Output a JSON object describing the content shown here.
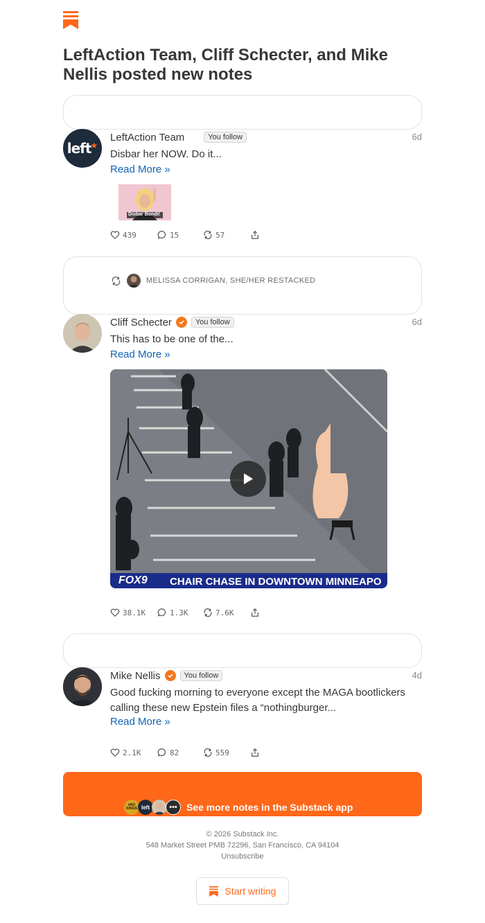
{
  "headline": "LeftAction Team, Cliff Schecter, and Mike Nellis posted new notes",
  "colors": {
    "brand": "#ff6719",
    "link": "#0f65b3",
    "verified": "#f4781f",
    "text": "#363737"
  },
  "notes": [
    {
      "author": "LeftAction Team",
      "verified": false,
      "follow_label": "You follow",
      "age": "6d",
      "text": "Disbar her NOW. Do it...",
      "read_more": "Read More",
      "avatar_text": "left",
      "image_caption": "Disbar Bondi!",
      "likes": "439",
      "comments": "15",
      "restacks": "57"
    },
    {
      "restacked_by": "MELISSA CORRIGAN, SHE/HER RESTACKED",
      "author": "Cliff Schecter",
      "verified": true,
      "follow_label": "You follow",
      "age": "6d",
      "text": "This has to be one of the...",
      "read_more": "Read More",
      "video_channel": "FOX9",
      "video_caption": "CHAIR CHASE IN DOWNTOWN MINNEAPO",
      "likes": "38.1K",
      "comments": "1.3K",
      "restacks": "7.6K"
    },
    {
      "author": "Mike Nellis",
      "verified": true,
      "follow_label": "You follow",
      "age": "4d",
      "text": "Good fucking morning to everyone except the MAGA bootlickers calling these new Epstein files a “nothingburger...",
      "read_more": "Read More",
      "likes": "2.1K",
      "comments": "82",
      "restacks": "559"
    }
  ],
  "cta": {
    "label": "See more notes in the Substack app",
    "avatar_badges": [
      "#NO KINGS",
      "left"
    ]
  },
  "footer": {
    "copyright": "© 2026 Substack Inc.",
    "address": "548 Market Street PMB 72296, San Francisco, CA 94104",
    "unsubscribe": "Unsubscribe"
  },
  "start_writing": "Start writing"
}
